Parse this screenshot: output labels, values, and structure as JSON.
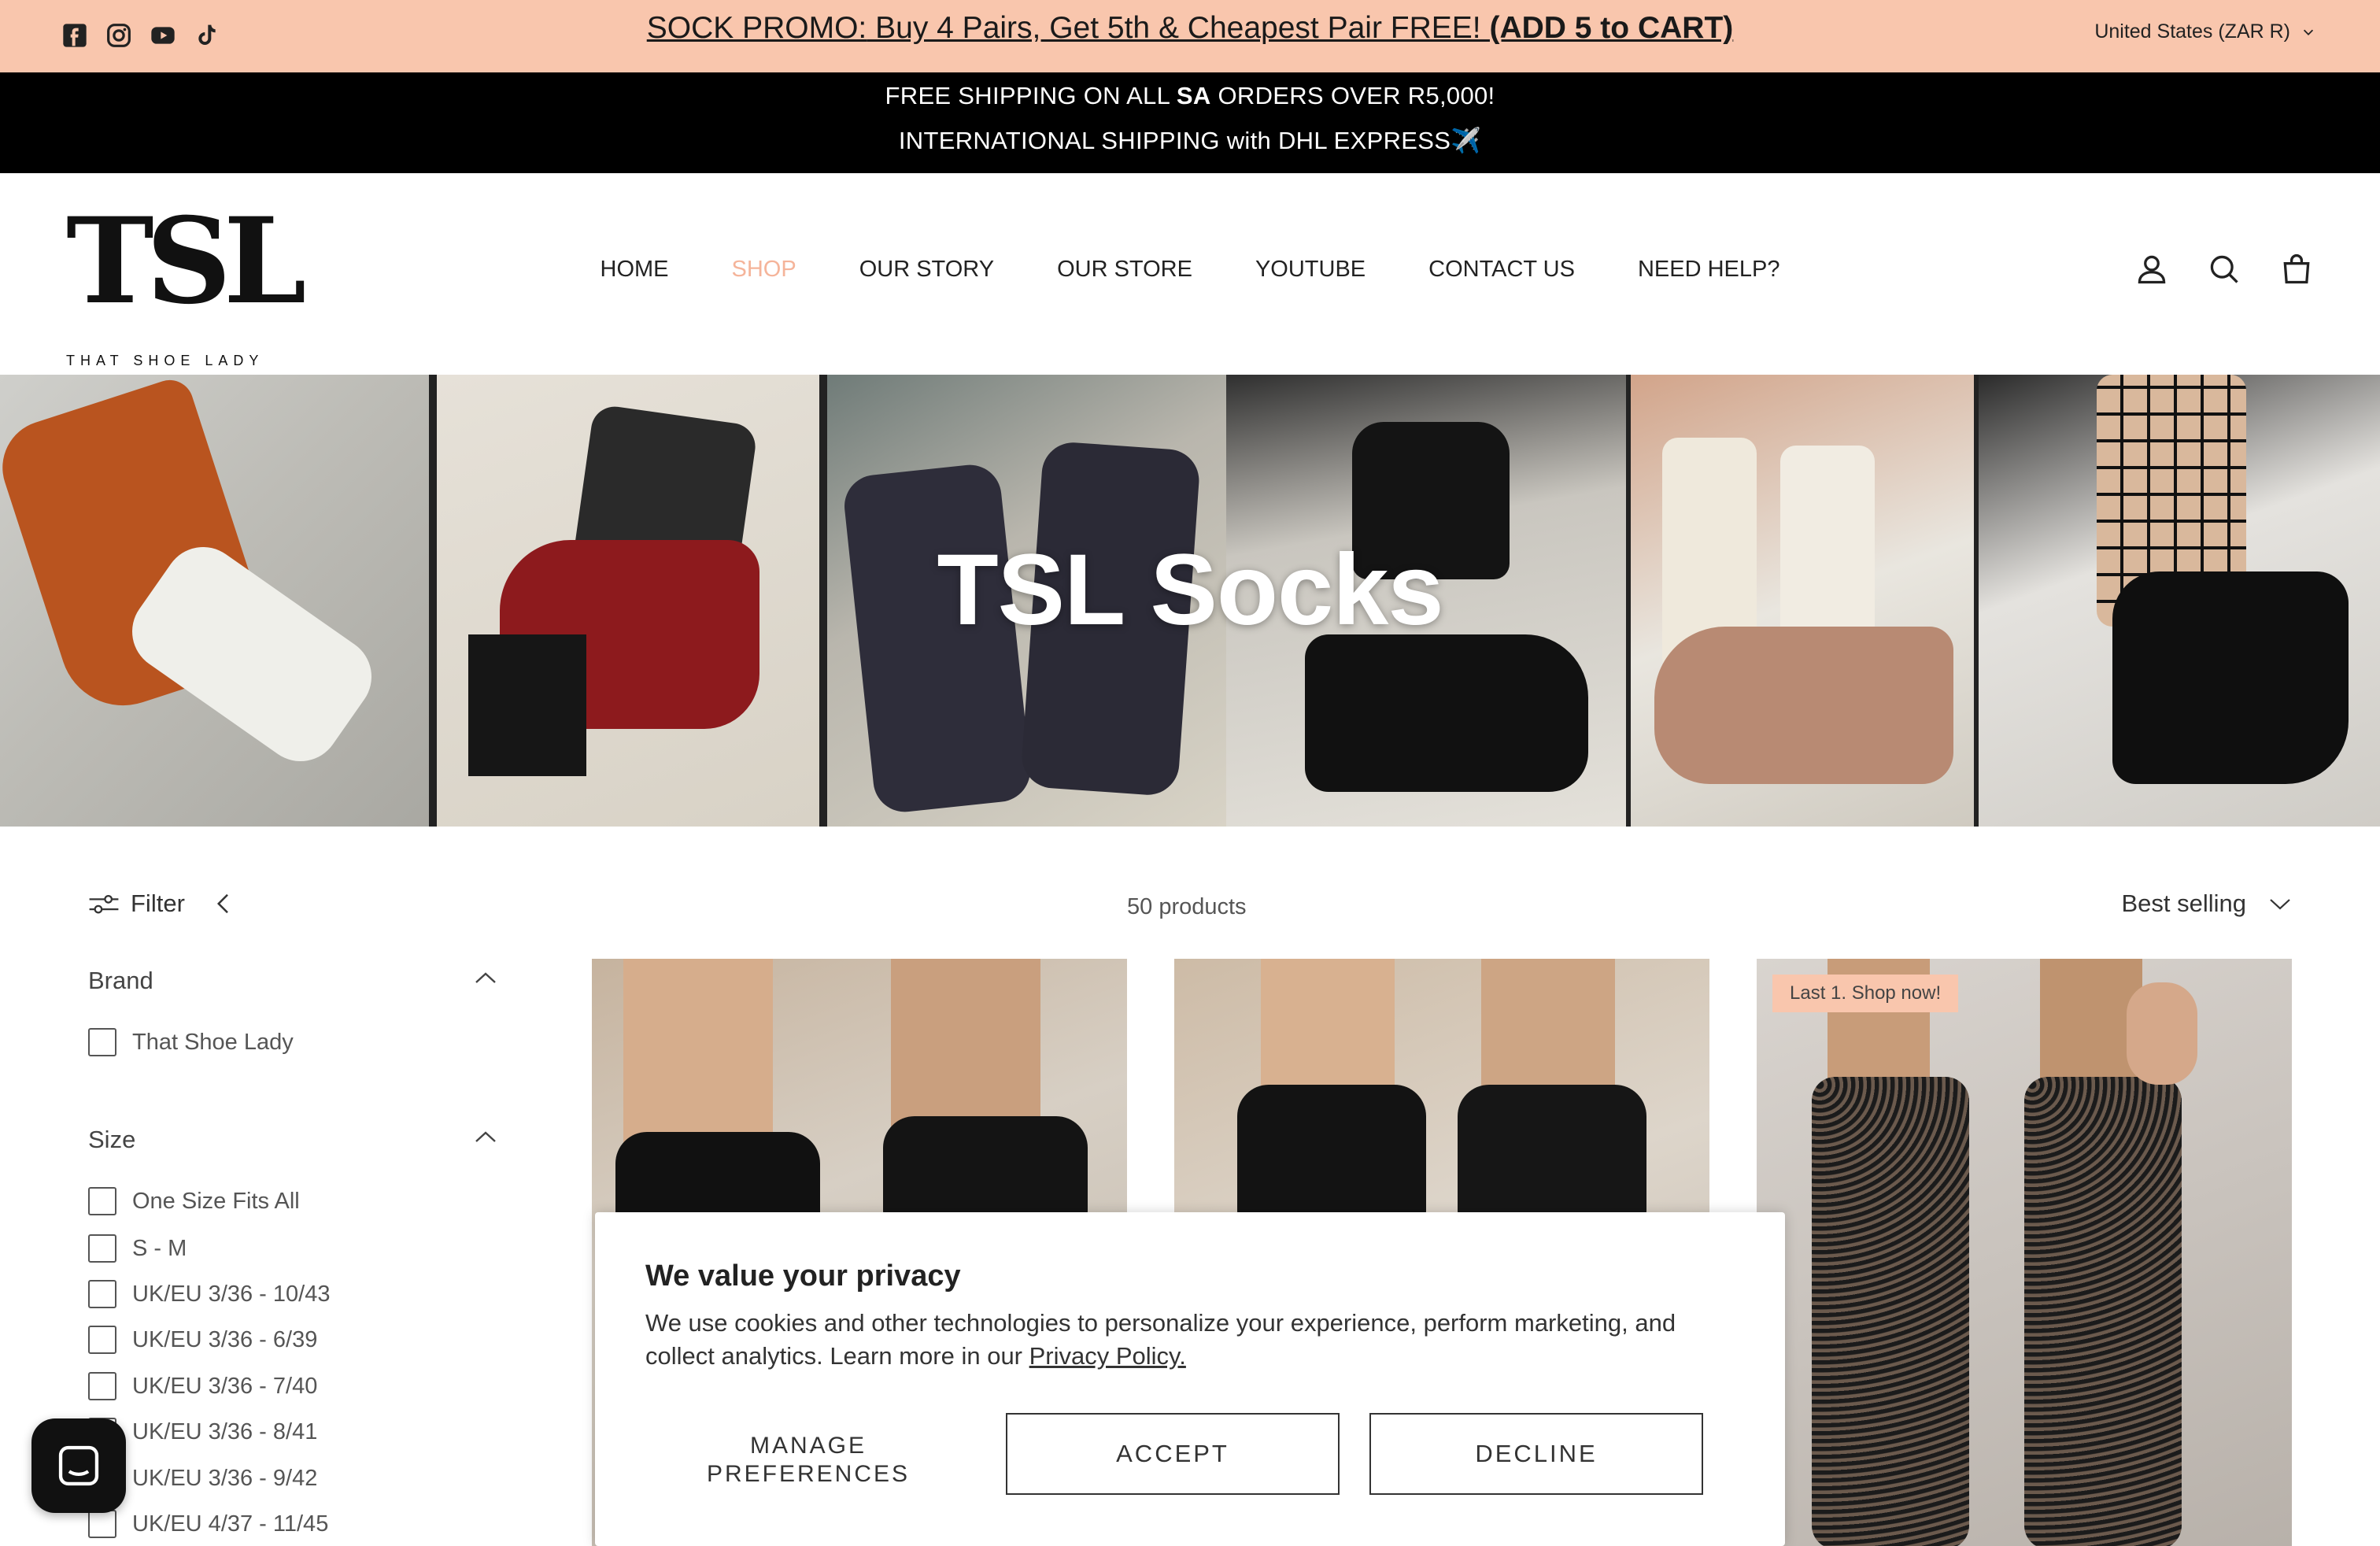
{
  "promo": {
    "prefix": "SOCK PROMO:",
    "middle": " Buy 4 Pairs, Get 5th & Cheapest Pair FREE! ",
    "suffix": "(ADD 5 to CART)"
  },
  "socials": [
    "facebook-icon",
    "instagram-icon",
    "youtube-icon",
    "tiktok-icon"
  ],
  "currency": "United States (ZAR R)",
  "shipping": {
    "line1_a": "FREE SHIPPING ON ALL ",
    "line1_b": "SA",
    "line1_c": " ORDERS OVER R5,000!",
    "line2": "INTERNATIONAL SHIPPING with DHL EXPRESS✈️"
  },
  "logo": {
    "mark": "TSL",
    "sub": "THAT SHOE LADY"
  },
  "nav": [
    "HOME",
    "SHOP",
    "OUR STORY",
    "OUR STORE",
    "YOUTUBE",
    "CONTACT US",
    "NEED HELP?"
  ],
  "nav_active": "SHOP",
  "hero": {
    "title": "TSL Socks"
  },
  "toolbar": {
    "filter": "Filter",
    "count": "50 products",
    "sort": "Best selling"
  },
  "filters": {
    "brand": {
      "title": "Brand",
      "options": [
        "That Shoe Lady"
      ]
    },
    "size": {
      "title": "Size",
      "options": [
        "One Size Fits All",
        "S - M",
        "UK/EU 3/36 - 10/43",
        "UK/EU 3/36 - 6/39",
        "UK/EU 3/36 - 7/40",
        "UK/EU 3/36 - 8/41",
        "UK/EU 3/36 - 9/42",
        "UK/EU 4/37 - 11/45"
      ]
    }
  },
  "products": {
    "badge": "Last 1. Shop now!"
  },
  "cookie": {
    "title": "We value your privacy",
    "text": "We use cookies and other technologies to personalize your experience, perform marketing, and collect analytics. Learn more in our ",
    "link": "Privacy Policy.",
    "manage": "MANAGE PREFERENCES",
    "accept": "ACCEPT",
    "decline": "DECLINE"
  },
  "colors": {
    "promo_bg": "#f9c6ad",
    "nav_active": "#f5b49a",
    "shipping_bg": "#000000"
  }
}
